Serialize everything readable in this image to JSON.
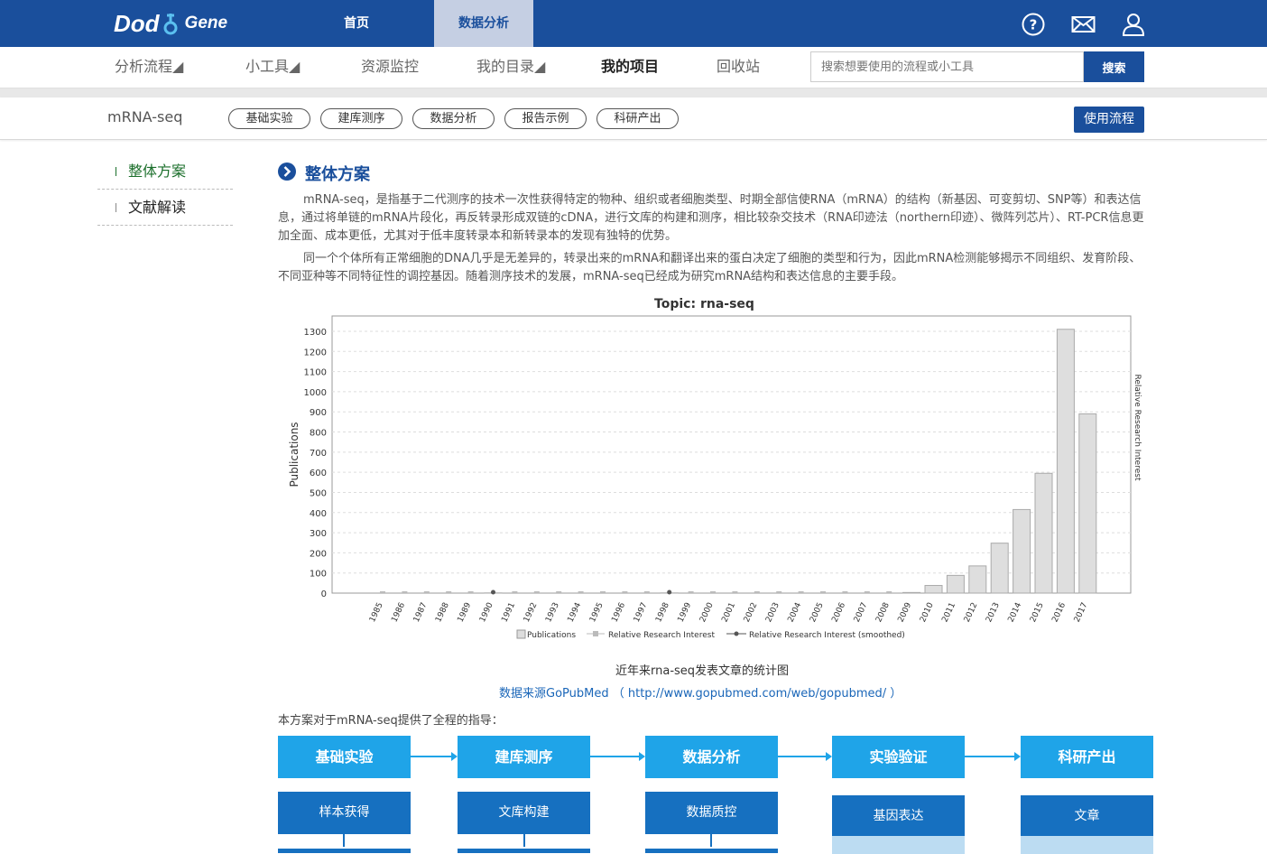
{
  "header": {
    "logo_part1": "Dod",
    "logo_part2": "Gene",
    "nav": [
      {
        "label": "首页"
      },
      {
        "label": "数据分析"
      }
    ],
    "icons": [
      "help-icon",
      "mail-icon",
      "user-icon"
    ]
  },
  "subnav": {
    "items": [
      "分析流程◢",
      "小工具◢",
      "资源监控",
      "我的目录◢",
      "我的项目",
      "回收站"
    ],
    "active": "我的项目",
    "search_placeholder": "搜索想要使用的流程或小工具",
    "search_button": "搜索"
  },
  "project": {
    "title": "mRNA-seq",
    "pills": [
      "基础实验",
      "建库测序",
      "数据分析",
      "报告示例",
      "科研产出"
    ],
    "use_button": "使用流程"
  },
  "sidebar": {
    "items": [
      {
        "label": "整体方案",
        "active": true
      },
      {
        "label": "文献解读",
        "active": false
      }
    ]
  },
  "content": {
    "section_title": "整体方案",
    "para1": "mRNA-seq，是指基于二代测序的技术一次性获得特定的物种、组织或者细胞类型、时期全部信使RNA（mRNA）的结构（新基因、可变剪切、SNP等）和表达信息，通过将单链的mRNA片段化，再反转录形成双链的cDNA，进行文库的构建和测序，相比较杂交技术（RNA印迹法（northern印迹）、微阵列芯片）、RT-PCR信息更加全面、成本更低，尤其对于低丰度转录本和新转录本的发现有独特的优势。",
    "para2": "同一个个体所有正常细胞的DNA几乎是无差异的，转录出来的mRNA和翻译出来的蛋白决定了细胞的类型和行为，因此mRNA检测能够揭示不同组织、发育阶段、不同亚种等不同特征性的调控基因。随着测序技术的发展，mRNA-seq已经成为研究mRNA结构和表达信息的主要手段。",
    "chart_caption": "近年来rna-seq发表文章的统计图",
    "source_text": "数据来源GoPubMed （ http://www.gopubmed.com/web/gopubmed/ ）",
    "guide_text": "本方案对于mRNA-seq提供了全程的指导："
  },
  "chart_data": {
    "type": "bar",
    "title": "Topic: rna-seq",
    "ylabel": "Publications",
    "y2label": "Relative Research Interest",
    "ylim": [
      0,
      1300
    ],
    "yticks": [
      0,
      100,
      200,
      300,
      400,
      500,
      600,
      700,
      800,
      900,
      1000,
      1100,
      1200,
      1300
    ],
    "categories": [
      "1985",
      "1986",
      "1987",
      "1988",
      "1989",
      "1990",
      "1991",
      "1992",
      "1993",
      "1994",
      "1995",
      "1996",
      "1997",
      "1998",
      "1999",
      "2000",
      "2001",
      "2002",
      "2003",
      "2004",
      "2005",
      "2006",
      "2007",
      "2008",
      "2009",
      "2010",
      "2011",
      "2012",
      "2013",
      "2014",
      "2015",
      "2016",
      "2017"
    ],
    "series": [
      {
        "name": "Publications",
        "values": [
          0,
          0,
          0,
          0,
          0,
          1,
          0,
          0,
          0,
          0,
          0,
          0,
          0,
          1,
          0,
          0,
          0,
          0,
          0,
          0,
          0,
          0,
          0,
          0,
          3,
          38,
          88,
          135,
          248,
          415,
          595,
          1310,
          890
        ]
      }
    ],
    "legend": [
      "Publications",
      "Relative Research Interest",
      "Relative Research Interest (smoothed)"
    ],
    "legend_position": "bottom",
    "grid": true,
    "colors": {
      "bar": "#dedede",
      "bar_border": "#aaaaaa"
    }
  },
  "flow": {
    "steps": [
      {
        "title": "基础实验",
        "sub": "样本获得"
      },
      {
        "title": "建库测序",
        "sub": "文库构建"
      },
      {
        "title": "数据分析",
        "sub": "数据质控"
      },
      {
        "title": "实验验证",
        "sub": "基因表达"
      },
      {
        "title": "科研产出",
        "sub": "文章"
      }
    ]
  },
  "colors": {
    "primary": "#1a4f9c",
    "accent": "#1fa4e8",
    "accent_dark": "#1670c0",
    "link": "#1a66b8"
  }
}
